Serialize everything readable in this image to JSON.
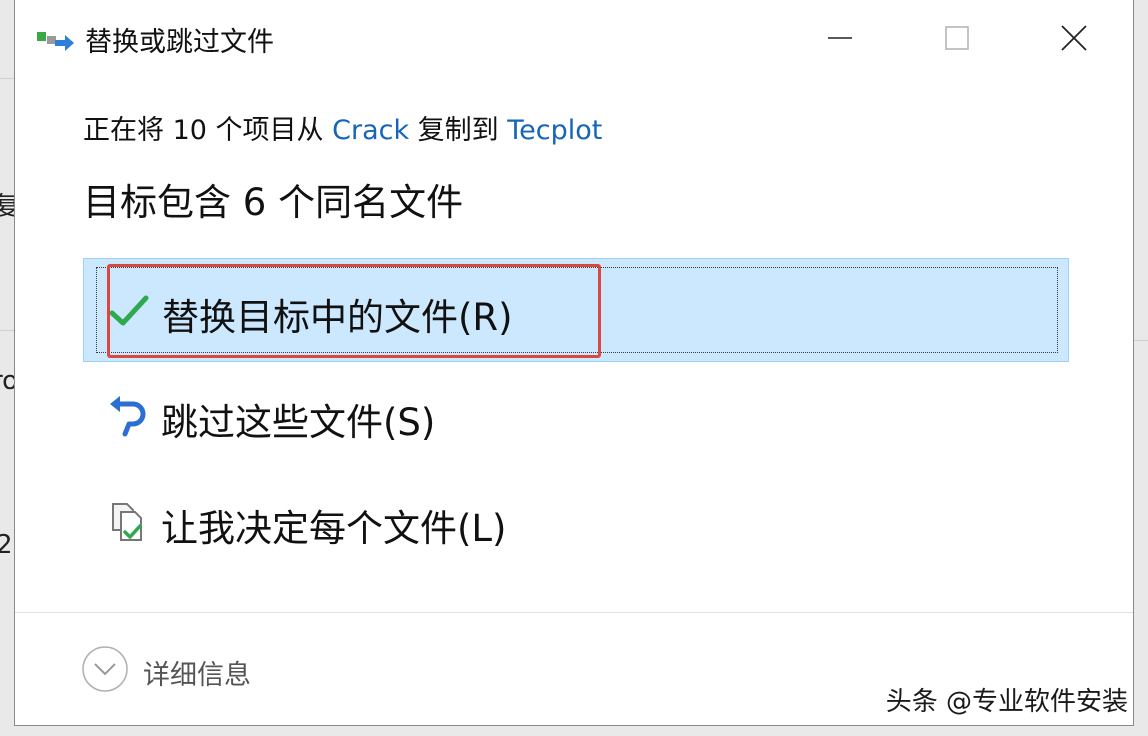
{
  "window": {
    "title": "替换或跳过文件"
  },
  "summary": {
    "prefix": "正在将 10 个项目从 ",
    "source": "Crack",
    "middle": " 复制到 ",
    "destination": "Tecplot"
  },
  "heading": "目标包含 6 个同名文件",
  "options": [
    {
      "label": "替换目标中的文件(R)",
      "icon": "checkmark-icon",
      "selected": true
    },
    {
      "label": "跳过这些文件(S)",
      "icon": "skip-arrow-icon",
      "selected": false
    },
    {
      "label": "让我决定每个文件(L)",
      "icon": "compare-files-icon",
      "selected": false
    }
  ],
  "footer": {
    "details_label": "详细信息"
  },
  "background": {
    "edge_chars": [
      "复",
      "ro",
      "2"
    ]
  },
  "watermark": "头条 @专业软件安装",
  "colors": {
    "link": "#1565b8",
    "selected_bg": "#cce8ff",
    "selected_border": "#99d1ff",
    "highlight": "#d9493f",
    "check": "#2fa84f",
    "skip_icon": "#2a6fd1"
  }
}
